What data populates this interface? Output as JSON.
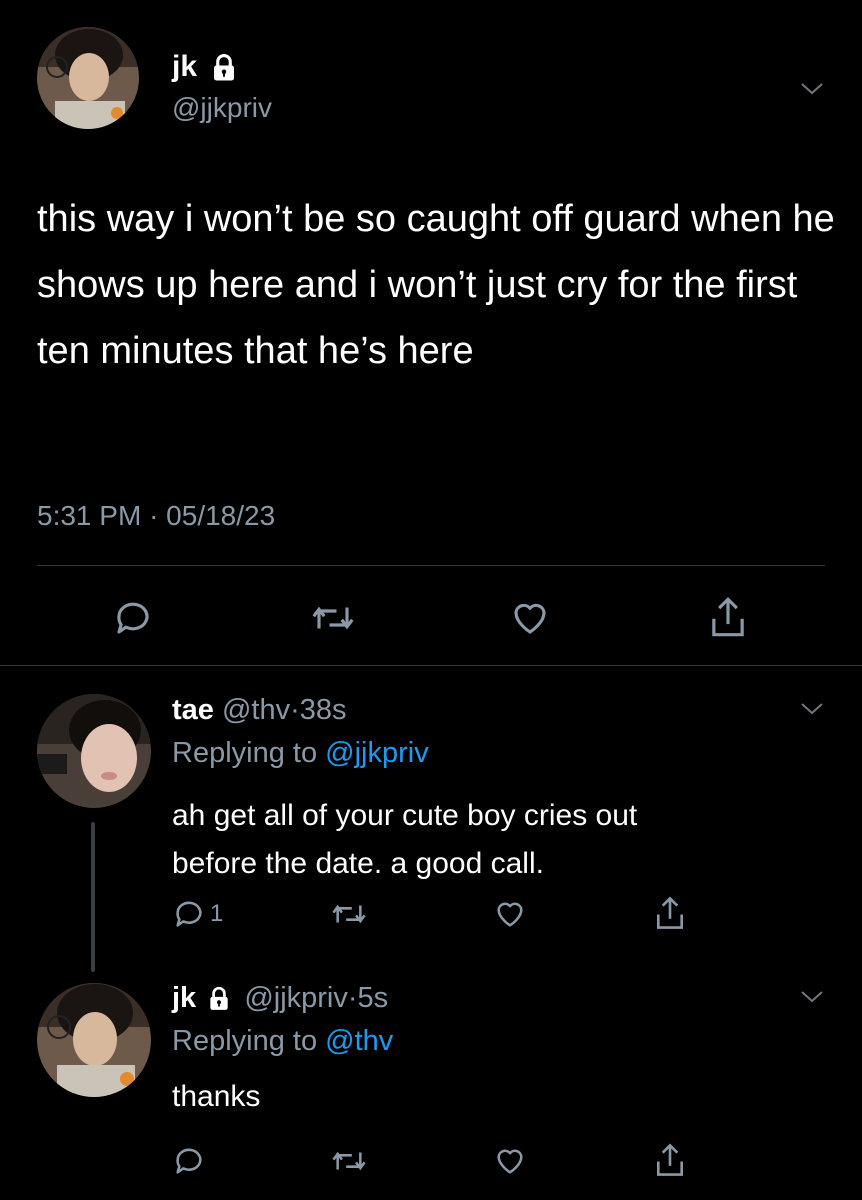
{
  "main_tweet": {
    "display_name": "jk",
    "handle": "@jjkpriv",
    "locked": true,
    "avatar": "user-avatar-photo",
    "text": "this way i won’t be so caught off guard when he shows up here and i won’t just cry for the first ten minutes that he’s here",
    "time": "5:31 PM",
    "separator": "·",
    "date": "05/18/23",
    "actions": [
      "reply-icon",
      "retweet-icon",
      "like-icon",
      "share-icon"
    ]
  },
  "reply1": {
    "display_name": "tae",
    "handle": "@thv",
    "separator": "·",
    "time_ago": "38s",
    "replying_prefix": "Replying to",
    "replying_to": "@jjkpriv",
    "text_line1": "ah get all of your cute boy cries out",
    "text_line2": "before the date. a good call.",
    "reply_count": "1",
    "avatar": "user-avatar-photo"
  },
  "reply2": {
    "display_name": "jk",
    "handle": "@jjkpriv",
    "separator": "·",
    "time_ago": "5s",
    "locked": true,
    "replying_prefix": "Replying to",
    "replying_to": "@thv",
    "text": "thanks",
    "avatar": "user-avatar-photo"
  },
  "colors": {
    "background": "#000000",
    "text": "#ffffff",
    "muted": "#8b98a5",
    "link": "#1d9bf0",
    "divider": "#2f3336"
  }
}
